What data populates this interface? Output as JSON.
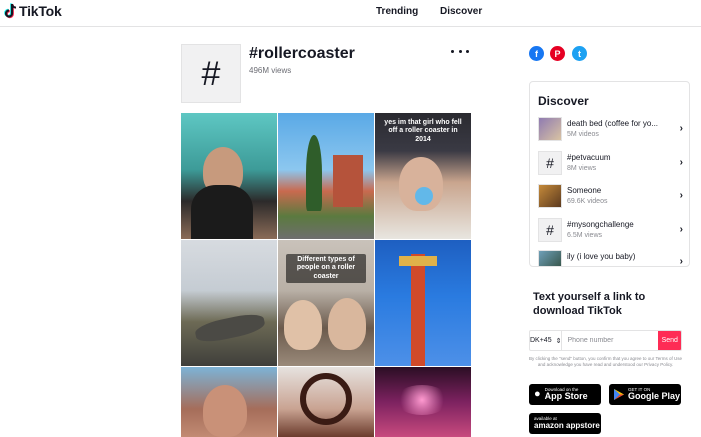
{
  "nav": {
    "logo": "TikTok",
    "links": [
      "Trending",
      "Discover"
    ]
  },
  "hashtag": {
    "symbol": "#",
    "title": "#rollercoaster",
    "views": "496M views"
  },
  "grid": {
    "captions": [
      "yes im that girl who fell off a roller coaster in 2014",
      "Different types of people on a roller coaster"
    ]
  },
  "social": {
    "facebook": "f",
    "pinterest": "P",
    "twitter": "t"
  },
  "discover": {
    "title": "Discover",
    "items": [
      {
        "name": "death bed (coffee for yo...",
        "count": "5M videos",
        "thumb": ""
      },
      {
        "name": "#petvacuum",
        "count": "8M views",
        "thumb": "#"
      },
      {
        "name": "Someone",
        "count": "69.6K videos",
        "thumb": ""
      },
      {
        "name": "#mysongchallenge",
        "count": "6.5M views",
        "thumb": "#"
      },
      {
        "name": "ily (i love you baby)",
        "count": "",
        "thumb": ""
      }
    ]
  },
  "sms": {
    "title": "Text yourself a link to download TikTok",
    "country": "DK+45",
    "phone_placeholder": "Phone number",
    "send": "Send",
    "legal": "By clicking the \"send\" button, you confirm that you agree to our Terms of Use and acknowledge you have read and understood our Privacy Policy."
  },
  "stores": {
    "appstore_small": "Download on the",
    "appstore_big": "App Store",
    "gplay_small": "GET IT ON",
    "gplay_big": "Google Play",
    "amazon_small": "available at",
    "amazon_big": "amazon appstore"
  },
  "colors": {
    "accent": "#fe2c55",
    "facebook": "#1877f2",
    "pinterest": "#e60023",
    "twitter": "#1da1f2"
  }
}
